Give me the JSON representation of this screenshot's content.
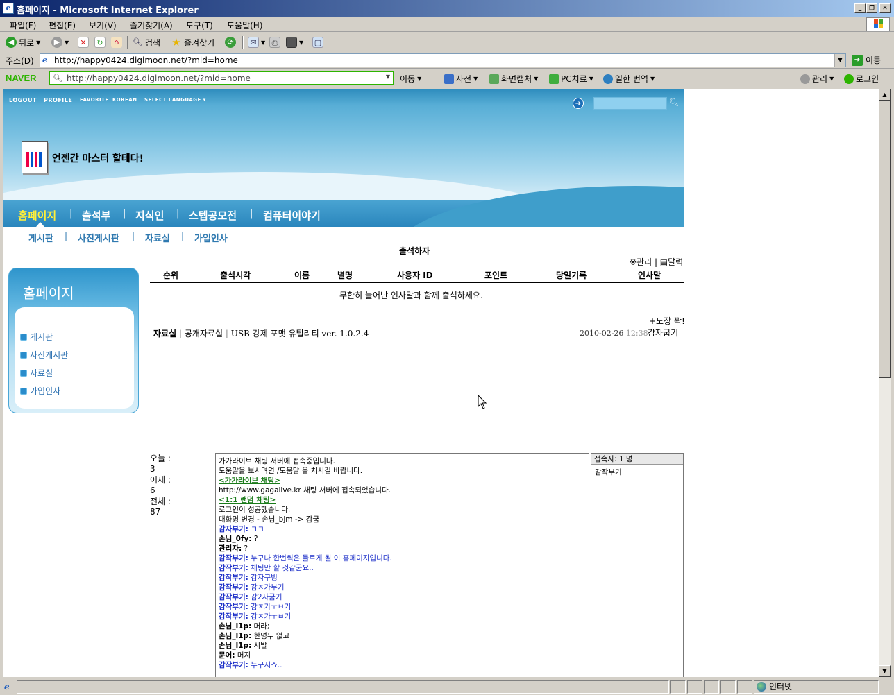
{
  "window": {
    "title": "홈페이지 - Microsoft Internet Explorer",
    "app_icon": "e"
  },
  "menu": [
    "파일(F)",
    "편집(E)",
    "보기(V)",
    "즐겨찾기(A)",
    "도구(T)",
    "도움말(H)"
  ],
  "toolbar": {
    "back": "뒤로",
    "search": "검색",
    "favorites": "즐겨찾기"
  },
  "address": {
    "label": "주소(D)",
    "url": "http://happy0424.digimoon.net/?mid=home",
    "go": "이동"
  },
  "naver": {
    "logo": "NAVER",
    "url": "http://happy0424.digimoon.net/?mid=home",
    "move": "이동",
    "dict": "사전",
    "capture": "화면캡처",
    "pc": "PC치료",
    "translate": "일한 번역",
    "manage": "관리",
    "login": "로그인"
  },
  "site": {
    "toplinks": [
      "LOGOUT",
      "PROFILE",
      "FAVORITE",
      "KOREAN",
      "SELECT LANGUAGE"
    ],
    "title": "언젠간 마스터 할테다!",
    "main_nav": [
      "홈페이지",
      "출석부",
      "지식인",
      "스텝공모전",
      "컴퓨터이야기"
    ],
    "sub_nav": [
      "게시판",
      "사진게시판",
      "자료실",
      "가입인사"
    ],
    "sidebar": {
      "title": "홈페이지",
      "items": [
        "게시판",
        "사진게시판",
        "자료실",
        "가입인사"
      ]
    }
  },
  "attendance": {
    "title": "출석하자",
    "links": "※관리 | ▤달력",
    "columns": [
      "순위",
      "출석시각",
      "이름",
      "별명",
      "사용자 ID",
      "포인트",
      "당일기록",
      "인사말"
    ],
    "message": "무한히 늘어난 인사말과 함께 출석하세요.",
    "stamp": "+도장 꽉!"
  },
  "latest": {
    "category": "자료실",
    "board": "공개자료실",
    "title": "USB 강제 포맷 유틸리티 ver. 1.0.2.4",
    "date": "2010-02-26",
    "time": "12:38",
    "user": "감자굽기"
  },
  "counter": {
    "today_label": "오늘 :",
    "today": "3",
    "yesterday_label": "어제 :",
    "yesterday": "6",
    "total_label": "전체 :",
    "total": "87"
  },
  "chat": {
    "lines": [
      {
        "text": "가가라이브 채팅 서버에 접속중입니다.",
        "kind": "plain"
      },
      {
        "text": "도움말을 보시려면 /도움말 을 치시길 바랍니다.",
        "kind": "plain"
      },
      {
        "text": "<가가라이브 채팅>",
        "kind": "link"
      },
      {
        "text": "http://www.gagalive.kr 채팅 서버에 접속되었습니다.",
        "kind": "plain"
      },
      {
        "text": "  <1:1 랜덤 채팅>",
        "kind": "link"
      },
      {
        "text": "로그인이 성공했습니다.",
        "kind": "plain"
      },
      {
        "text": "대화명 변경 - 손님_bjm -> 감굽",
        "kind": "plain"
      },
      {
        "nick": "감자부기:",
        "msg": " ㅋㅋ",
        "kind": "blue"
      },
      {
        "nick": "손님_0fy:",
        "msg": " ?",
        "kind": "black"
      },
      {
        "nick": "관리자:",
        "msg": " ?",
        "kind": "black"
      },
      {
        "nick": "감작부기:",
        "msg": " 누구나 한번씩은 들르게 될 이 홈페이지입니다.",
        "kind": "blue"
      },
      {
        "nick": "감작부기:",
        "msg": " 채팅만 할 것같군요..",
        "kind": "blue"
      },
      {
        "nick": "감작부기:",
        "msg": " 감자구빙",
        "kind": "blue"
      },
      {
        "nick": "감작부기:",
        "msg": " 감ㅈ가부기",
        "kind": "blue"
      },
      {
        "nick": "감작부기:",
        "msg": " 감2자굼기",
        "kind": "blue"
      },
      {
        "nick": "감작부기:",
        "msg": " 감ㅈ가ㅜㅂ기",
        "kind": "blue"
      },
      {
        "nick": "감작부기:",
        "msg": " 감ㅈ가ㅜㅂ기",
        "kind": "blue"
      },
      {
        "nick": "손님_l1p:",
        "msg": " 머라;",
        "kind": "black"
      },
      {
        "nick": "손님_l1p:",
        "msg": " 한명두 없고",
        "kind": "black"
      },
      {
        "nick": "손님_l1p:",
        "msg": " 시발",
        "kind": "black"
      },
      {
        "nick": "문어:",
        "msg": " 머지",
        "kind": "black"
      },
      {
        "nick": "감작부기:",
        "msg": " 누구시죠..",
        "kind": "blue"
      }
    ],
    "users_header": "접속자: 1 명",
    "users": [
      "감작부기"
    ]
  },
  "status": {
    "zone": "인터넷"
  }
}
